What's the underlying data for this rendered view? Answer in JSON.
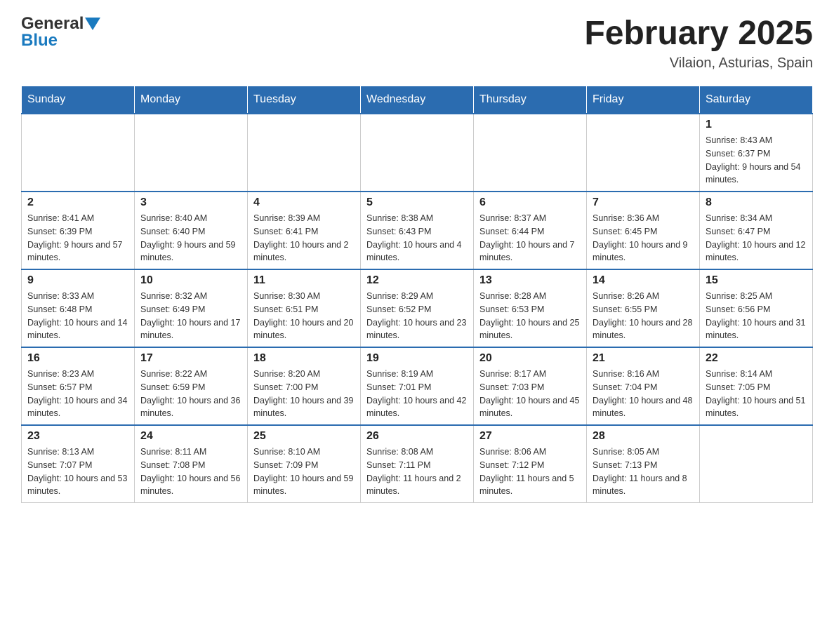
{
  "header": {
    "logo_line1": "General",
    "logo_line2": "Blue",
    "month_title": "February 2025",
    "location": "Vilaion, Asturias, Spain"
  },
  "days_of_week": [
    "Sunday",
    "Monday",
    "Tuesday",
    "Wednesday",
    "Thursday",
    "Friday",
    "Saturday"
  ],
  "weeks": [
    {
      "days": [
        {
          "date": "",
          "info": ""
        },
        {
          "date": "",
          "info": ""
        },
        {
          "date": "",
          "info": ""
        },
        {
          "date": "",
          "info": ""
        },
        {
          "date": "",
          "info": ""
        },
        {
          "date": "",
          "info": ""
        },
        {
          "date": "1",
          "info": "Sunrise: 8:43 AM\nSunset: 6:37 PM\nDaylight: 9 hours and 54 minutes."
        }
      ]
    },
    {
      "days": [
        {
          "date": "2",
          "info": "Sunrise: 8:41 AM\nSunset: 6:39 PM\nDaylight: 9 hours and 57 minutes."
        },
        {
          "date": "3",
          "info": "Sunrise: 8:40 AM\nSunset: 6:40 PM\nDaylight: 9 hours and 59 minutes."
        },
        {
          "date": "4",
          "info": "Sunrise: 8:39 AM\nSunset: 6:41 PM\nDaylight: 10 hours and 2 minutes."
        },
        {
          "date": "5",
          "info": "Sunrise: 8:38 AM\nSunset: 6:43 PM\nDaylight: 10 hours and 4 minutes."
        },
        {
          "date": "6",
          "info": "Sunrise: 8:37 AM\nSunset: 6:44 PM\nDaylight: 10 hours and 7 minutes."
        },
        {
          "date": "7",
          "info": "Sunrise: 8:36 AM\nSunset: 6:45 PM\nDaylight: 10 hours and 9 minutes."
        },
        {
          "date": "8",
          "info": "Sunrise: 8:34 AM\nSunset: 6:47 PM\nDaylight: 10 hours and 12 minutes."
        }
      ]
    },
    {
      "days": [
        {
          "date": "9",
          "info": "Sunrise: 8:33 AM\nSunset: 6:48 PM\nDaylight: 10 hours and 14 minutes."
        },
        {
          "date": "10",
          "info": "Sunrise: 8:32 AM\nSunset: 6:49 PM\nDaylight: 10 hours and 17 minutes."
        },
        {
          "date": "11",
          "info": "Sunrise: 8:30 AM\nSunset: 6:51 PM\nDaylight: 10 hours and 20 minutes."
        },
        {
          "date": "12",
          "info": "Sunrise: 8:29 AM\nSunset: 6:52 PM\nDaylight: 10 hours and 23 minutes."
        },
        {
          "date": "13",
          "info": "Sunrise: 8:28 AM\nSunset: 6:53 PM\nDaylight: 10 hours and 25 minutes."
        },
        {
          "date": "14",
          "info": "Sunrise: 8:26 AM\nSunset: 6:55 PM\nDaylight: 10 hours and 28 minutes."
        },
        {
          "date": "15",
          "info": "Sunrise: 8:25 AM\nSunset: 6:56 PM\nDaylight: 10 hours and 31 minutes."
        }
      ]
    },
    {
      "days": [
        {
          "date": "16",
          "info": "Sunrise: 8:23 AM\nSunset: 6:57 PM\nDaylight: 10 hours and 34 minutes."
        },
        {
          "date": "17",
          "info": "Sunrise: 8:22 AM\nSunset: 6:59 PM\nDaylight: 10 hours and 36 minutes."
        },
        {
          "date": "18",
          "info": "Sunrise: 8:20 AM\nSunset: 7:00 PM\nDaylight: 10 hours and 39 minutes."
        },
        {
          "date": "19",
          "info": "Sunrise: 8:19 AM\nSunset: 7:01 PM\nDaylight: 10 hours and 42 minutes."
        },
        {
          "date": "20",
          "info": "Sunrise: 8:17 AM\nSunset: 7:03 PM\nDaylight: 10 hours and 45 minutes."
        },
        {
          "date": "21",
          "info": "Sunrise: 8:16 AM\nSunset: 7:04 PM\nDaylight: 10 hours and 48 minutes."
        },
        {
          "date": "22",
          "info": "Sunrise: 8:14 AM\nSunset: 7:05 PM\nDaylight: 10 hours and 51 minutes."
        }
      ]
    },
    {
      "days": [
        {
          "date": "23",
          "info": "Sunrise: 8:13 AM\nSunset: 7:07 PM\nDaylight: 10 hours and 53 minutes."
        },
        {
          "date": "24",
          "info": "Sunrise: 8:11 AM\nSunset: 7:08 PM\nDaylight: 10 hours and 56 minutes."
        },
        {
          "date": "25",
          "info": "Sunrise: 8:10 AM\nSunset: 7:09 PM\nDaylight: 10 hours and 59 minutes."
        },
        {
          "date": "26",
          "info": "Sunrise: 8:08 AM\nSunset: 7:11 PM\nDaylight: 11 hours and 2 minutes."
        },
        {
          "date": "27",
          "info": "Sunrise: 8:06 AM\nSunset: 7:12 PM\nDaylight: 11 hours and 5 minutes."
        },
        {
          "date": "28",
          "info": "Sunrise: 8:05 AM\nSunset: 7:13 PM\nDaylight: 11 hours and 8 minutes."
        },
        {
          "date": "",
          "info": ""
        }
      ]
    }
  ]
}
